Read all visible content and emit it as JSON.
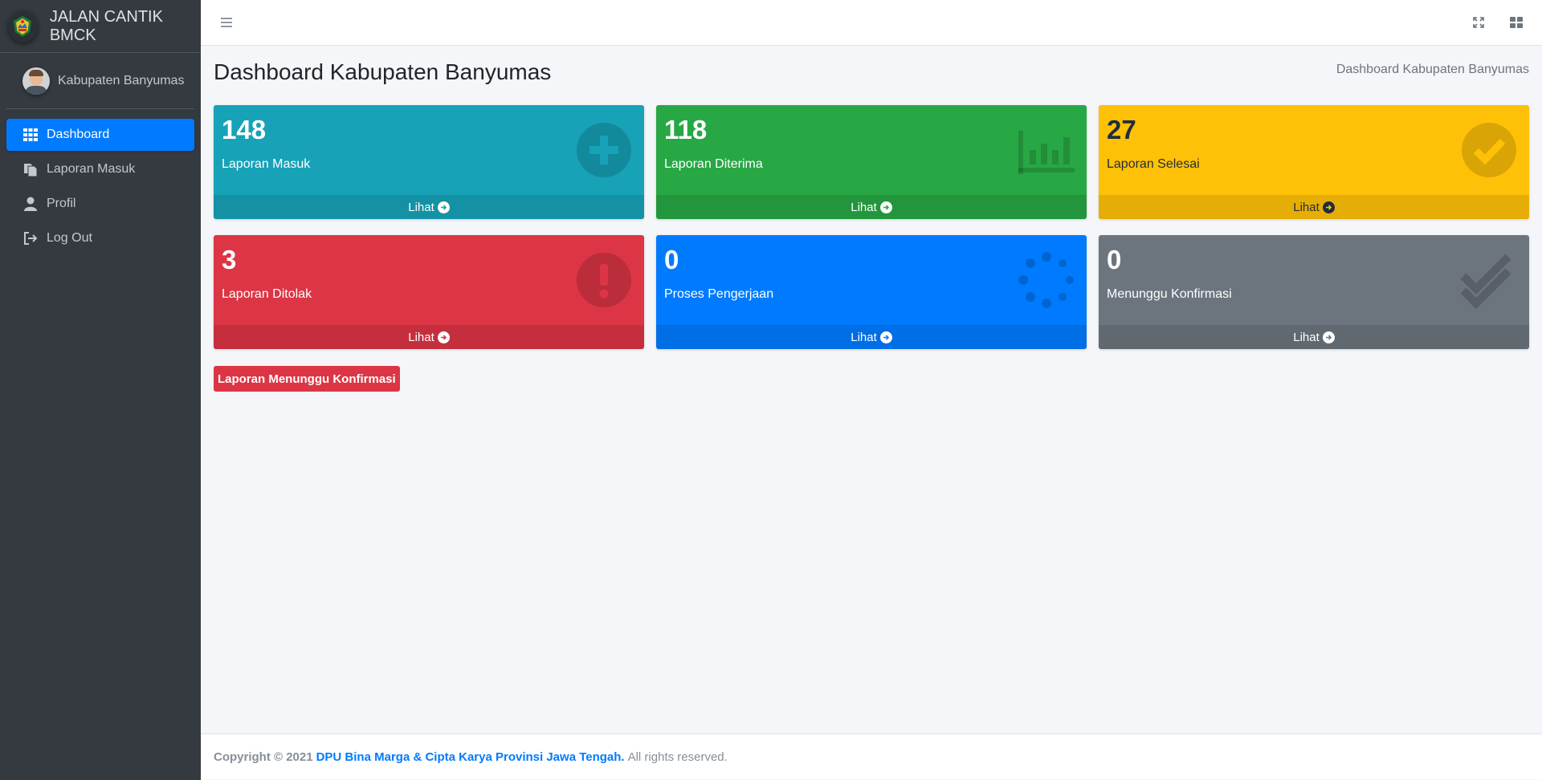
{
  "brand": {
    "title": "JALAN CANTIK BMCK"
  },
  "user": {
    "name": "Kabupaten Banyumas"
  },
  "sidebar": {
    "items": [
      {
        "label": "Dashboard",
        "icon": "grid-icon",
        "active": true
      },
      {
        "label": "Laporan Masuk",
        "icon": "copy-icon"
      },
      {
        "label": "Profil",
        "icon": "user-icon"
      },
      {
        "label": "Log Out",
        "icon": "sign-out-icon"
      }
    ]
  },
  "topbar": {
    "menu_icon": "bars-icon",
    "fullscreen_icon": "expand-icon",
    "layout_icon": "th-large-icon"
  },
  "page": {
    "title": "Dashboard Kabupaten Banyumas",
    "breadcrumb": "Dashboard Kabupaten Banyumas"
  },
  "boxes": [
    {
      "value": "148",
      "label": "Laporan Masuk",
      "link": "Lihat",
      "color": "#17a2b8",
      "icon": "plus-circle-icon"
    },
    {
      "value": "118",
      "label": "Laporan Diterima",
      "link": "Lihat",
      "color": "#28a745",
      "icon": "chart-bar-icon"
    },
    {
      "value": "27",
      "label": "Laporan Selesai",
      "link": "Lihat",
      "color": "#ffc107",
      "icon": "check-circle-icon"
    },
    {
      "value": "3",
      "label": "Laporan Ditolak",
      "link": "Lihat",
      "color": "#dc3545",
      "icon": "exclamation-circle-icon"
    },
    {
      "value": "0",
      "label": "Proses Pengerjaan",
      "link": "Lihat",
      "color": "#007bff",
      "icon": "spinner-icon"
    },
    {
      "value": "0",
      "label": "Menunggu Konfirmasi",
      "link": "Lihat",
      "color": "#6c757d",
      "icon": "check-double-icon"
    }
  ],
  "button": {
    "label": "Laporan Menunggu Konfirmasi"
  },
  "footer": {
    "copyright": "Copyright © 2021",
    "org": "DPU Bina Marga & Cipta Karya Provinsi Jawa Tengah.",
    "rights": "All rights reserved."
  }
}
